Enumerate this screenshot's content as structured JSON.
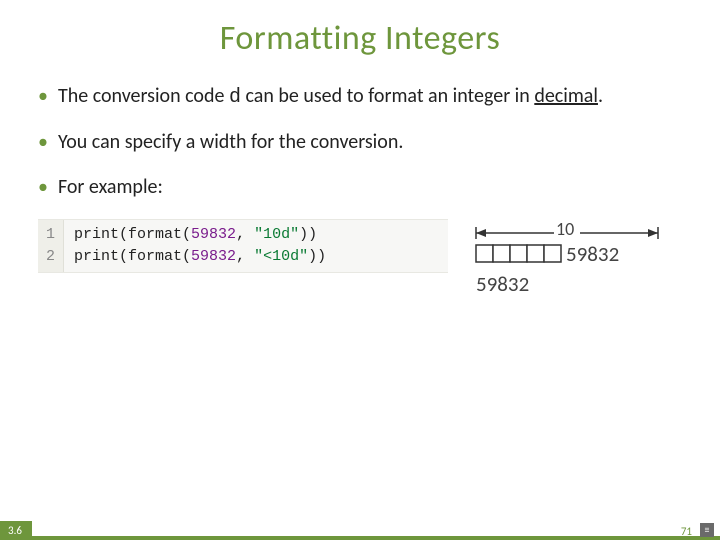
{
  "title": "Formatting Integers",
  "bullets": {
    "b1_pre": "The conversion code ",
    "b1_code": "d",
    "b1_mid": " can be used to format an integer in ",
    "b1_u": "decimal",
    "b1_post": ".",
    "b2": "You can specify a width for the conversion.",
    "b3": "For example:"
  },
  "code": {
    "gutter": "1\n2",
    "l1_a": "print(format(",
    "l1_n": "59832",
    "l1_b": ", ",
    "l1_s": "\"10d\"",
    "l1_c": "))",
    "l2_a": "print(format(",
    "l2_n": "59832",
    "l2_b": ", ",
    "l2_s": "\"<10d\"",
    "l2_c": "))"
  },
  "diagram": {
    "width_label": "10",
    "num": "59832"
  },
  "footer": {
    "section": "3.6",
    "page": "71"
  }
}
